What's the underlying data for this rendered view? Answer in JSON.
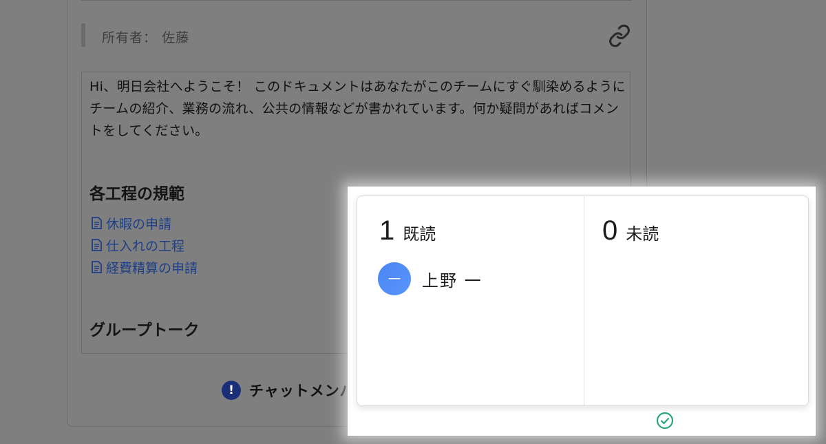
{
  "document": {
    "owner_label": "所有者：",
    "owner_name": "佐藤",
    "intro": "Hi、明日会社へようこそ！ このドキュメントはあなたがこのチームにすぐ馴染めるようにチームの紹介、業務の流れ、公共の情報などが書かれています。何か疑問があればコメントをしてください。",
    "section_rules": "各工程の規範",
    "links": [
      {
        "label": "休暇の申請",
        "icon": "file-icon"
      },
      {
        "label": "仕入れの工程",
        "icon": "file-icon"
      },
      {
        "label": "経費精算の申請",
        "icon": "file-icon"
      }
    ],
    "section_group": "グループトーク",
    "chat_notice": "チャットメンバ"
  },
  "read_status": {
    "read_count": "1",
    "read_label": "既読",
    "unread_count": "0",
    "unread_label": "未読",
    "readers": [
      {
        "avatar_text": "一",
        "name": "上野 一",
        "avatar_color": "#4a86f0"
      }
    ]
  },
  "colors": {
    "accent": "#4a86f0",
    "link": "#1e3f86",
    "check": "#2aa57a"
  }
}
